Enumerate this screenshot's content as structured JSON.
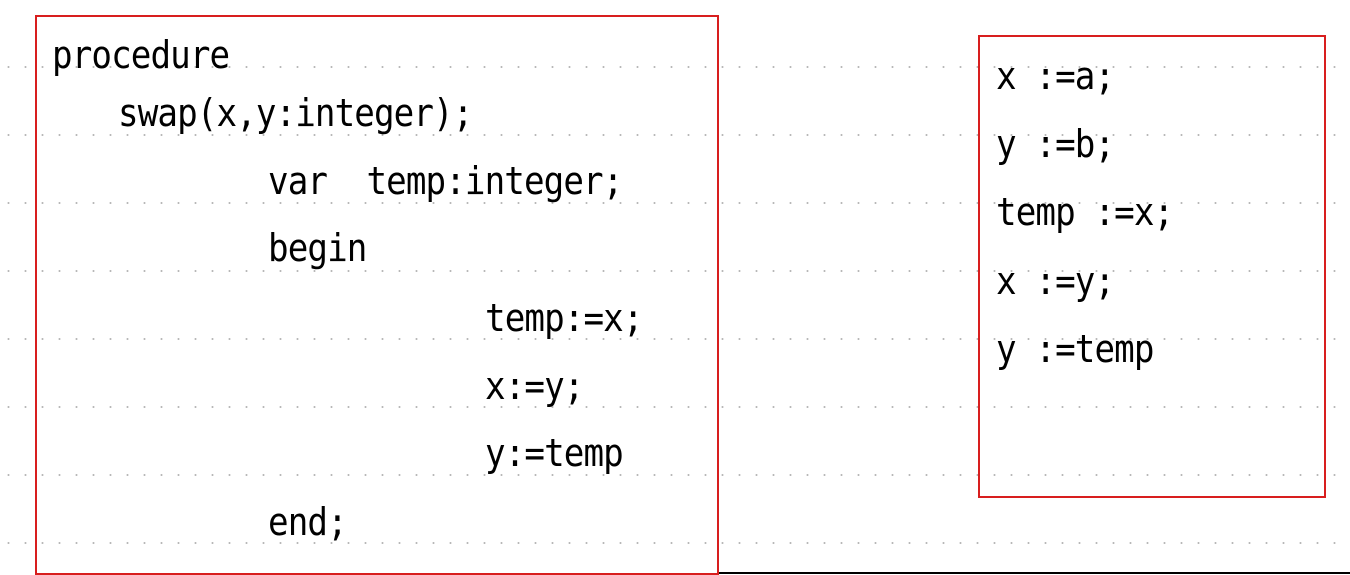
{
  "procedure_block": {
    "lines": [
      "procedure",
      "swap(x,y:integer);",
      "var  temp:integer;",
      "begin",
      "temp:=x;",
      "x:=y;",
      "y:=temp",
      "end;"
    ]
  },
  "assignment_block": {
    "lines": [
      "x :=a;",
      "y :=b;",
      "temp :=x;",
      "x :=y;",
      "y :=temp"
    ]
  },
  "colors": {
    "box_border": "#d81e1e",
    "text": "#000000",
    "grid_dots": "#b8b8b8"
  }
}
